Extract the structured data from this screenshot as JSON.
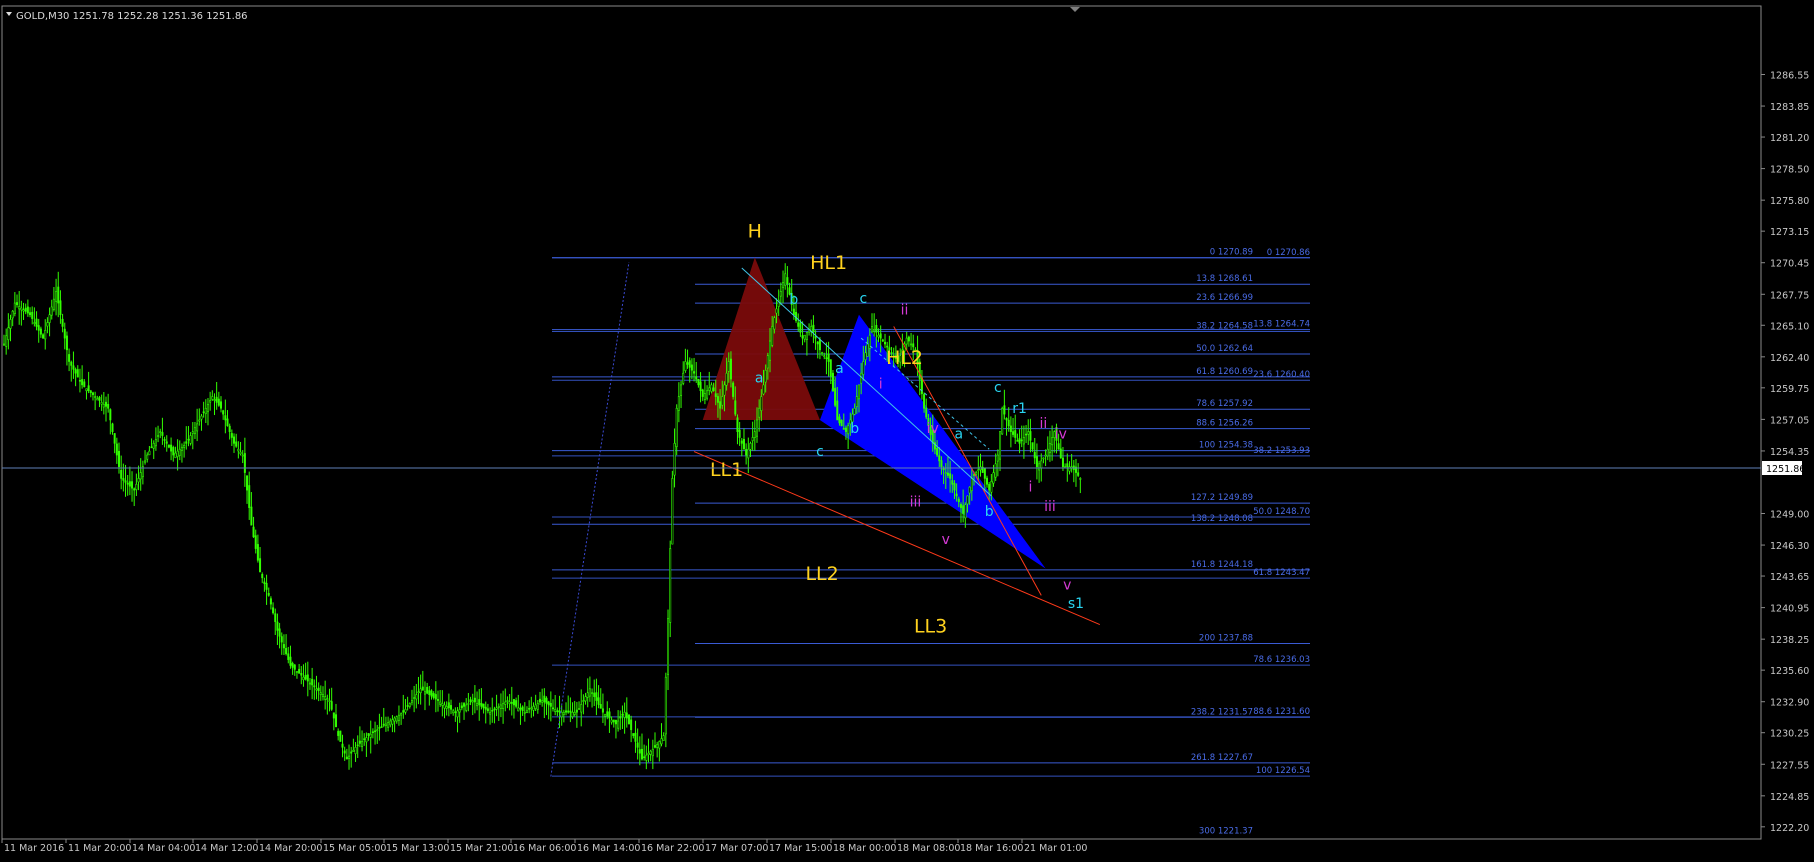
{
  "symbol_header": "GOLD,M30  1251.78 1252.28 1251.36 1251.86",
  "current_price": "1251.86",
  "chart_data": {
    "type": "candlestick",
    "symbol": "GOLD",
    "timeframe": "M30",
    "ylim": [
      1221.5,
      1289.5
    ],
    "price_ticks": [
      "1286.55",
      "1283.85",
      "1281.20",
      "1278.50",
      "1275.80",
      "1273.15",
      "1270.45",
      "1267.75",
      "1265.10",
      "1262.40",
      "1259.75",
      "1257.05",
      "1254.35",
      "1251.86",
      "1249.00",
      "1246.30",
      "1243.65",
      "1240.95",
      "1238.25",
      "1235.60",
      "1232.90",
      "1230.25",
      "1227.55",
      "1224.85",
      "1222.20"
    ],
    "time_ticks": [
      "11 Mar 2016",
      "11 Mar 20:00",
      "14 Mar 04:00",
      "14 Mar 12:00",
      "14 Mar 20:00",
      "15 Mar 05:00",
      "15 Mar 13:00",
      "15 Mar 21:00",
      "16 Mar 06:00",
      "16 Mar 14:00",
      "16 Mar 22:00",
      "17 Mar 07:00",
      "17 Mar 15:00",
      "18 Mar 00:00",
      "18 Mar 08:00",
      "18 Mar 16:00",
      "21 Mar 01:00"
    ],
    "close_path": [
      [
        0,
        1263.5
      ],
      [
        5,
        1267
      ],
      [
        12,
        1266
      ],
      [
        18,
        1264
      ],
      [
        24,
        1268
      ],
      [
        30,
        1262
      ],
      [
        36,
        1260
      ],
      [
        42,
        1259
      ],
      [
        48,
        1258
      ],
      [
        54,
        1252
      ],
      [
        60,
        1251
      ],
      [
        66,
        1254
      ],
      [
        72,
        1256
      ],
      [
        78,
        1254
      ],
      [
        84,
        1255
      ],
      [
        90,
        1257
      ],
      [
        96,
        1259
      ],
      [
        100,
        1258
      ],
      [
        106,
        1255
      ],
      [
        110,
        1254
      ],
      [
        114,
        1248
      ],
      [
        118,
        1244
      ],
      [
        122,
        1242
      ],
      [
        126,
        1239
      ],
      [
        132,
        1236
      ],
      [
        138,
        1235
      ],
      [
        144,
        1234
      ],
      [
        150,
        1233
      ],
      [
        154,
        1230
      ],
      [
        158,
        1228
      ],
      [
        162,
        1229
      ],
      [
        168,
        1230
      ],
      [
        176,
        1231
      ],
      [
        184,
        1232
      ],
      [
        192,
        1234
      ],
      [
        200,
        1233
      ],
      [
        208,
        1232
      ],
      [
        216,
        1233
      ],
      [
        224,
        1232
      ],
      [
        232,
        1233
      ],
      [
        240,
        1232
      ],
      [
        248,
        1233
      ],
      [
        256,
        1232
      ],
      [
        264,
        1232
      ],
      [
        270,
        1234
      ],
      [
        276,
        1232
      ],
      [
        282,
        1231
      ],
      [
        286,
        1232
      ],
      [
        290,
        1230
      ],
      [
        294,
        1228
      ],
      [
        300,
        1229
      ],
      [
        304,
        1230
      ],
      [
        306,
        1240
      ],
      [
        308,
        1252
      ],
      [
        310,
        1258
      ],
      [
        314,
        1262
      ],
      [
        318,
        1261
      ],
      [
        322,
        1259
      ],
      [
        326,
        1260
      ],
      [
        330,
        1258
      ],
      [
        334,
        1262
      ],
      [
        338,
        1256
      ],
      [
        342,
        1254
      ],
      [
        346,
        1256
      ],
      [
        350,
        1260
      ],
      [
        354,
        1265
      ],
      [
        358,
        1268
      ],
      [
        360,
        1269.5
      ],
      [
        364,
        1266
      ],
      [
        368,
        1264
      ],
      [
        372,
        1265
      ],
      [
        376,
        1263
      ],
      [
        380,
        1262
      ],
      [
        384,
        1257
      ],
      [
        388,
        1256
      ],
      [
        392,
        1258
      ],
      [
        396,
        1262
      ],
      [
        400,
        1265
      ],
      [
        404,
        1264
      ],
      [
        408,
        1263
      ],
      [
        412,
        1262
      ],
      [
        416,
        1264
      ],
      [
        420,
        1263
      ],
      [
        424,
        1258
      ],
      [
        428,
        1255
      ],
      [
        432,
        1253
      ],
      [
        436,
        1252
      ],
      [
        440,
        1250
      ],
      [
        442,
        1249
      ],
      [
        446,
        1252
      ],
      [
        450,
        1253
      ],
      [
        454,
        1251
      ],
      [
        458,
        1254
      ],
      [
        460,
        1258
      ],
      [
        464,
        1256
      ],
      [
        468,
        1255
      ],
      [
        472,
        1256
      ],
      [
        476,
        1253
      ],
      [
        480,
        1254
      ],
      [
        484,
        1256
      ],
      [
        488,
        1253
      ],
      [
        492,
        1253
      ],
      [
        496,
        1252
      ]
    ]
  },
  "fib_levels_left": [
    {
      "label": "0 1270.89",
      "price": 1270.89
    },
    {
      "label": "13.8 1268.61",
      "price": 1268.61
    },
    {
      "label": "23.6 1266.99",
      "price": 1266.99
    },
    {
      "label": "38.2 1264.58",
      "price": 1264.58
    },
    {
      "label": "50.0 1262.64",
      "price": 1262.64
    },
    {
      "label": "61.8 1260.69",
      "price": 1260.69
    },
    {
      "label": "78.6 1257.92",
      "price": 1257.92
    },
    {
      "label": "88.6 1256.26",
      "price": 1256.26
    },
    {
      "label": "100 1254.38",
      "price": 1254.38
    },
    {
      "label": "127.2 1249.89",
      "price": 1249.89
    },
    {
      "label": "138.2 1248.08",
      "price": 1248.08
    },
    {
      "label": "161.8 1244.18",
      "price": 1244.18
    },
    {
      "label": "200 1237.88",
      "price": 1237.88
    },
    {
      "label": "238.2 1231.57",
      "price": 1231.57
    },
    {
      "label": "261.8 1227.67",
      "price": 1227.67
    },
    {
      "label": "300 1221.37",
      "price": 1221.37
    }
  ],
  "fib_levels_right": [
    {
      "label": "0 1270.86",
      "price": 1270.86
    },
    {
      "label": "13.8 1264.74",
      "price": 1264.74
    },
    {
      "label": "23.6 1260.40",
      "price": 1260.4
    },
    {
      "label": "38.2 1253.93",
      "price": 1253.93
    },
    {
      "label": "50.0 1248.70",
      "price": 1248.7
    },
    {
      "label": "61.8 1243.47",
      "price": 1243.47
    },
    {
      "label": "78.6 1236.03",
      "price": 1236.03
    },
    {
      "label": "88.6 1231.60",
      "price": 1231.6
    },
    {
      "label": "100 1226.54",
      "price": 1226.54
    }
  ],
  "annotations": {
    "H": "H",
    "HL1": "HL1",
    "HL2": "HL2",
    "LL1": "LL1",
    "LL2": "LL2",
    "LL3": "LL3",
    "a1": "a",
    "b1": "b",
    "c1": "c",
    "a2": "a",
    "b2": "b",
    "c2": "c",
    "a3": "a",
    "b3": "b",
    "c3": "c",
    "r1": "r1",
    "s1": "s1",
    "i1": "i",
    "ii1": "ii",
    "iii1": "iii",
    "iv1": "iv",
    "v1": "v",
    "i2": "i",
    "ii2": "ii",
    "iii2": "iii",
    "iv2": "iv",
    "v2": "v"
  },
  "colors": {
    "background": "#000000",
    "grid": "#3a3a3a",
    "candles": "#32ff00",
    "fib_lines": "#3a5bd4",
    "fib_text": "#4a6ce8",
    "cyan_label": "#29d4f0",
    "yellow_label": "#ffd21e",
    "magenta_label": "#d63ad6",
    "red_triangle": "#7a0b0b",
    "blue_triangle": "#0000ff",
    "trendline_red": "#ff3a1a",
    "trendline_cyan": "#3fc4e8"
  }
}
